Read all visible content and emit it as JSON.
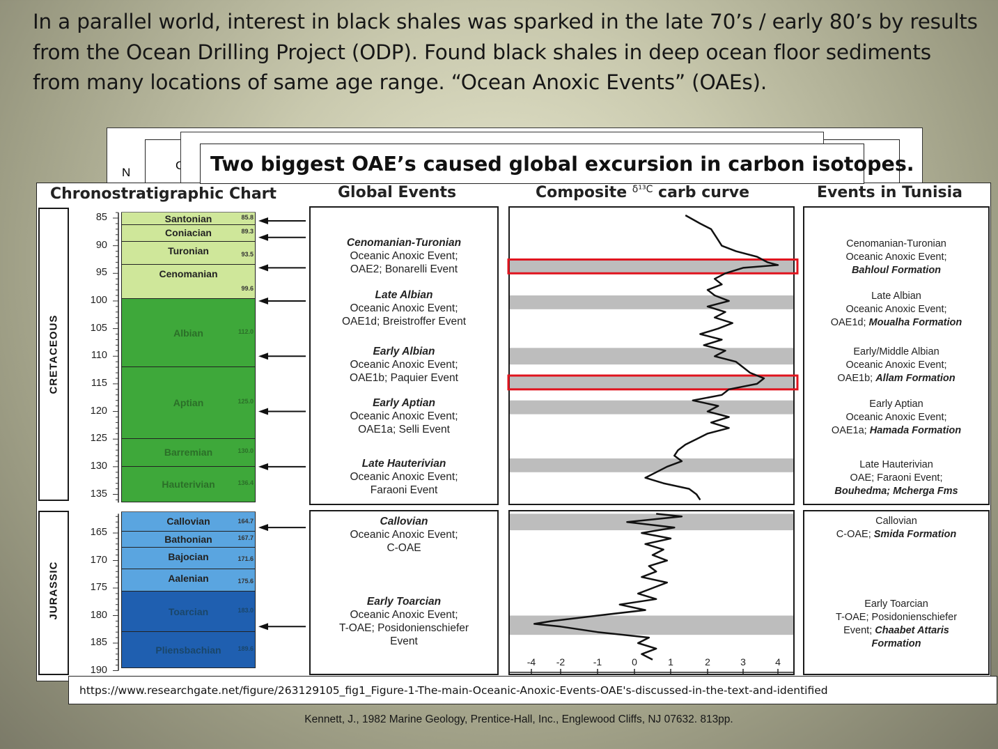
{
  "intro": {
    "line1": "In a parallel world, interest in black shales was sparked in the late 70’s / early 80’s by results",
    "line2": "from the Ocean Drilling Project (ODP).  Found black shales in deep ocean floor sediments",
    "line3": "from many locations of same age range.  “Ocean Anoxic Events” (OAEs)."
  },
  "backsheet_fragments": {
    "n": "N",
    "c": "C"
  },
  "callout": "Two biggest OAE’s caused global excursion in carbon isotopes.",
  "headers": {
    "chrono": "Chronostratigraphic Chart",
    "global": "Global Events",
    "composite_pre": "Composite",
    "composite_delta": "δ¹³C",
    "composite_post": "carb curve",
    "tunisia": "Events in Tunisia"
  },
  "chart_data": {
    "type": "line",
    "title": "Composite δ¹³C carb curve",
    "eras": [
      {
        "name": "CRETACEOUS",
        "range": [
          84,
          136
        ]
      },
      {
        "name": "JURASSIC",
        "range": [
          161,
          190
        ]
      }
    ],
    "age_ticks": {
      "cretaceous": [
        85,
        90,
        95,
        100,
        105,
        110,
        115,
        120,
        125,
        130,
        135
      ],
      "jurassic": [
        165,
        170,
        175,
        180,
        185,
        190
      ]
    },
    "stages": [
      {
        "name": "Santonian",
        "top": 84,
        "bottom": 86.3,
        "age": "85.8",
        "color": "#cfe79a"
      },
      {
        "name": "Coniacian",
        "top": 86.3,
        "bottom": 89.3,
        "age": "89.3",
        "color": "#cfe79a"
      },
      {
        "name": "Turonian",
        "top": 89.3,
        "bottom": 93.5,
        "age": "93.5",
        "color": "#cfe79a"
      },
      {
        "name": "Cenomanian",
        "top": 93.5,
        "bottom": 99.6,
        "age": "99.6",
        "color": "#cfe79a"
      },
      {
        "name": "Albian",
        "top": 99.6,
        "bottom": 112.0,
        "age": "112.0",
        "color": "#3ea83a"
      },
      {
        "name": "Aptian",
        "top": 112.0,
        "bottom": 125.0,
        "age": "125.0",
        "color": "#3ea83a"
      },
      {
        "name": "Barremian",
        "top": 125.0,
        "bottom": 130.0,
        "age": "130.0",
        "color": "#3ea83a"
      },
      {
        "name": "Hauterivian",
        "top": 130.0,
        "bottom": 136.4,
        "age": "136.4",
        "color": "#3ea83a"
      },
      {
        "name": "Callovian",
        "top": 161.2,
        "bottom": 164.7,
        "age": "164.7",
        "color": "#5aa5e0"
      },
      {
        "name": "Bathonian",
        "top": 164.7,
        "bottom": 167.7,
        "age": "167.7",
        "color": "#5aa5e0"
      },
      {
        "name": "Bajocian",
        "top": 167.7,
        "bottom": 171.6,
        "age": "171.6",
        "color": "#5aa5e0"
      },
      {
        "name": "Aalenian",
        "top": 171.6,
        "bottom": 175.6,
        "age": "175.6",
        "color": "#5aa5e0"
      },
      {
        "name": "Toarcian",
        "top": 175.6,
        "bottom": 183.0,
        "age": "183.0",
        "color": "#1f5fb0"
      },
      {
        "name": "Pliensbachian",
        "top": 183.0,
        "bottom": 189.6,
        "age": "189.6",
        "color": "#1f5fb0"
      }
    ],
    "event_arrow_ages": [
      85.5,
      88.5,
      94,
      100,
      110,
      120,
      130,
      164,
      182
    ],
    "grey_bands": [
      {
        "from": 92.5,
        "to": 95.0
      },
      {
        "from": 99.0,
        "to": 101.5
      },
      {
        "from": 108.5,
        "to": 111.5
      },
      {
        "from": 113.5,
        "to": 116.0
      },
      {
        "from": 118.0,
        "to": 120.5
      },
      {
        "from": 128.5,
        "to": 131.0
      },
      {
        "from": 161.5,
        "to": 164.5
      },
      {
        "from": 180.0,
        "to": 183.5
      }
    ],
    "highlighted_bands": [
      {
        "from": 92.5,
        "to": 95.0
      },
      {
        "from": 113.5,
        "to": 116.0
      }
    ],
    "x_ticks": [
      -4,
      -2,
      -1,
      0,
      1,
      2,
      3,
      4
    ],
    "xlim": [
      -4,
      4
    ],
    "curve": [
      {
        "age": 84.5,
        "d13c": 1.4
      },
      {
        "age": 86,
        "d13c": 1.8
      },
      {
        "age": 87,
        "d13c": 2.1
      },
      {
        "age": 88,
        "d13c": 2.2
      },
      {
        "age": 89,
        "d13c": 2.3
      },
      {
        "age": 90,
        "d13c": 2.4
      },
      {
        "age": 91,
        "d13c": 2.8
      },
      {
        "age": 92,
        "d13c": 3.4
      },
      {
        "age": 93,
        "d13c": 3.7
      },
      {
        "age": 93.5,
        "d13c": 4.2
      },
      {
        "age": 94,
        "d13c": 3.0
      },
      {
        "age": 95,
        "d13c": 2.5
      },
      {
        "age": 96,
        "d13c": 2.2
      },
      {
        "age": 97,
        "d13c": 2.4
      },
      {
        "age": 98,
        "d13c": 2.0
      },
      {
        "age": 99,
        "d13c": 2.2
      },
      {
        "age": 100,
        "d13c": 2.6
      },
      {
        "age": 101,
        "d13c": 2.0
      },
      {
        "age": 102,
        "d13c": 2.5
      },
      {
        "age": 103,
        "d13c": 2.2
      },
      {
        "age": 104,
        "d13c": 2.7
      },
      {
        "age": 105,
        "d13c": 2.3
      },
      {
        "age": 106,
        "d13c": 1.8
      },
      {
        "age": 107,
        "d13c": 2.4
      },
      {
        "age": 108,
        "d13c": 1.9
      },
      {
        "age": 109,
        "d13c": 2.5
      },
      {
        "age": 110,
        "d13c": 2.2
      },
      {
        "age": 111,
        "d13c": 2.8
      },
      {
        "age": 112,
        "d13c": 3.0
      },
      {
        "age": 113,
        "d13c": 3.2
      },
      {
        "age": 114,
        "d13c": 3.6
      },
      {
        "age": 115,
        "d13c": 3.4
      },
      {
        "age": 116,
        "d13c": 2.6
      },
      {
        "age": 117,
        "d13c": 2.4
      },
      {
        "age": 118,
        "d13c": 1.6
      },
      {
        "age": 119,
        "d13c": 2.3
      },
      {
        "age": 120,
        "d13c": 2.0
      },
      {
        "age": 121,
        "d13c": 2.6
      },
      {
        "age": 122,
        "d13c": 2.1
      },
      {
        "age": 123,
        "d13c": 2.6
      },
      {
        "age": 124,
        "d13c": 2.0
      },
      {
        "age": 125,
        "d13c": 1.7
      },
      {
        "age": 126,
        "d13c": 1.4
      },
      {
        "age": 127,
        "d13c": 1.2
      },
      {
        "age": 128,
        "d13c": 1.1
      },
      {
        "age": 129,
        "d13c": 1.3
      },
      {
        "age": 130,
        "d13c": 0.9
      },
      {
        "age": 131,
        "d13c": 0.6
      },
      {
        "age": 132,
        "d13c": 0.3
      },
      {
        "age": 133,
        "d13c": 0.8
      },
      {
        "age": 134,
        "d13c": 1.5
      },
      {
        "age": 135,
        "d13c": 1.7
      },
      {
        "age": 136,
        "d13c": 1.8
      },
      {
        "age": 161.5,
        "d13c": 0.6
      },
      {
        "age": 162,
        "d13c": 1.3
      },
      {
        "age": 163,
        "d13c": -0.2
      },
      {
        "age": 164,
        "d13c": 1.1
      },
      {
        "age": 165,
        "d13c": 0.2
      },
      {
        "age": 166,
        "d13c": 1.0
      },
      {
        "age": 167,
        "d13c": 0.3
      },
      {
        "age": 168,
        "d13c": 0.8
      },
      {
        "age": 169,
        "d13c": 0.5
      },
      {
        "age": 170,
        "d13c": 0.9
      },
      {
        "age": 171,
        "d13c": 0.4
      },
      {
        "age": 172,
        "d13c": 0.6
      },
      {
        "age": 173,
        "d13c": 0.2
      },
      {
        "age": 174,
        "d13c": 0.9
      },
      {
        "age": 175,
        "d13c": 0.5
      },
      {
        "age": 176,
        "d13c": 0.1
      },
      {
        "age": 177,
        "d13c": 0.6
      },
      {
        "age": 178,
        "d13c": -0.4
      },
      {
        "age": 179,
        "d13c": 0.3
      },
      {
        "age": 180,
        "d13c": -1.0
      },
      {
        "age": 181,
        "d13c": -2.6
      },
      {
        "age": 181.5,
        "d13c": -3.8
      },
      {
        "age": 182,
        "d13c": -2.0
      },
      {
        "age": 183,
        "d13c": -1.0
      },
      {
        "age": 184,
        "d13c": 0.4
      },
      {
        "age": 185,
        "d13c": 0.1
      },
      {
        "age": 186,
        "d13c": 0.6
      },
      {
        "age": 187,
        "d13c": 0.2
      },
      {
        "age": 188,
        "d13c": 0.5
      }
    ]
  },
  "global_events": [
    {
      "title": "Cenomanian-Turonian",
      "lines": [
        "Oceanic Anoxic Event;",
        "OAE2; Bonarelli Event"
      ]
    },
    {
      "title": "Late Albian",
      "lines": [
        "Oceanic Anoxic Event;",
        "OAE1d; Breistroffer Event"
      ]
    },
    {
      "title": "Early Albian",
      "lines": [
        "Oceanic Anoxic Event;",
        "OAE1b; Paquier Event"
      ]
    },
    {
      "title": "Early Aptian",
      "lines": [
        "Oceanic Anoxic Event;",
        "OAE1a; Selli Event"
      ]
    },
    {
      "title": "Late Hauterivian",
      "lines": [
        "Oceanic Anoxic Event;",
        "Faraoni Event"
      ]
    },
    {
      "title": "Callovian",
      "lines": [
        "Oceanic Anoxic Event;",
        "C-OAE"
      ]
    },
    {
      "title": "Early Toarcian",
      "lines": [
        "Oceanic Anoxic Event;",
        "T-OAE; Posidonienschiefer",
        "Event"
      ]
    }
  ],
  "tunisia_events": [
    {
      "lines": [
        "Cenomanian-Turonian",
        "Oceanic Anoxic Event;"
      ],
      "bold": "Bahloul Formation"
    },
    {
      "lines": [
        "Late Albian",
        "Oceanic Anoxic Event;"
      ],
      "prefix": "OAE1d; ",
      "bold": "Moualha Formation"
    },
    {
      "lines": [
        "Early/Middle Albian",
        "Oceanic Anoxic Event;"
      ],
      "prefix": "OAE1b; ",
      "bold": "Allam Formation"
    },
    {
      "lines": [
        "Early Aptian",
        "Oceanic Anoxic Event;"
      ],
      "prefix": "OAE1a; ",
      "bold": "Hamada Formation"
    },
    {
      "lines": [
        "Late Hauterivian",
        "OAE; Faraoni Event;"
      ],
      "bold": "Bouhedma; Mcherga Fms"
    },
    {
      "lines": [
        "Callovian"
      ],
      "prefix": "C-OAE; ",
      "bold": "Smida Formation"
    },
    {
      "lines": [
        "Early Toarcian",
        "T-OAE; Posidonienschiefer"
      ],
      "prefix": "Event; ",
      "bold": "Chaabet Attaris",
      "bold2": "Formation"
    }
  ],
  "url": "https://www.researchgate.net/figure/263129105_fig1_Figure-1-The-main-Oceanic-Anoxic-Events-OAE's-discussed-in-the-text-and-identified",
  "citation": "Kennett, J., 1982 Marine Geology, Prentice-Hall, Inc., Englewood Cliffs, NJ 07632. 813pp.",
  "colors": {
    "highlight": "#e0141e",
    "band": "#bdbdbd",
    "curve": "#111111"
  }
}
